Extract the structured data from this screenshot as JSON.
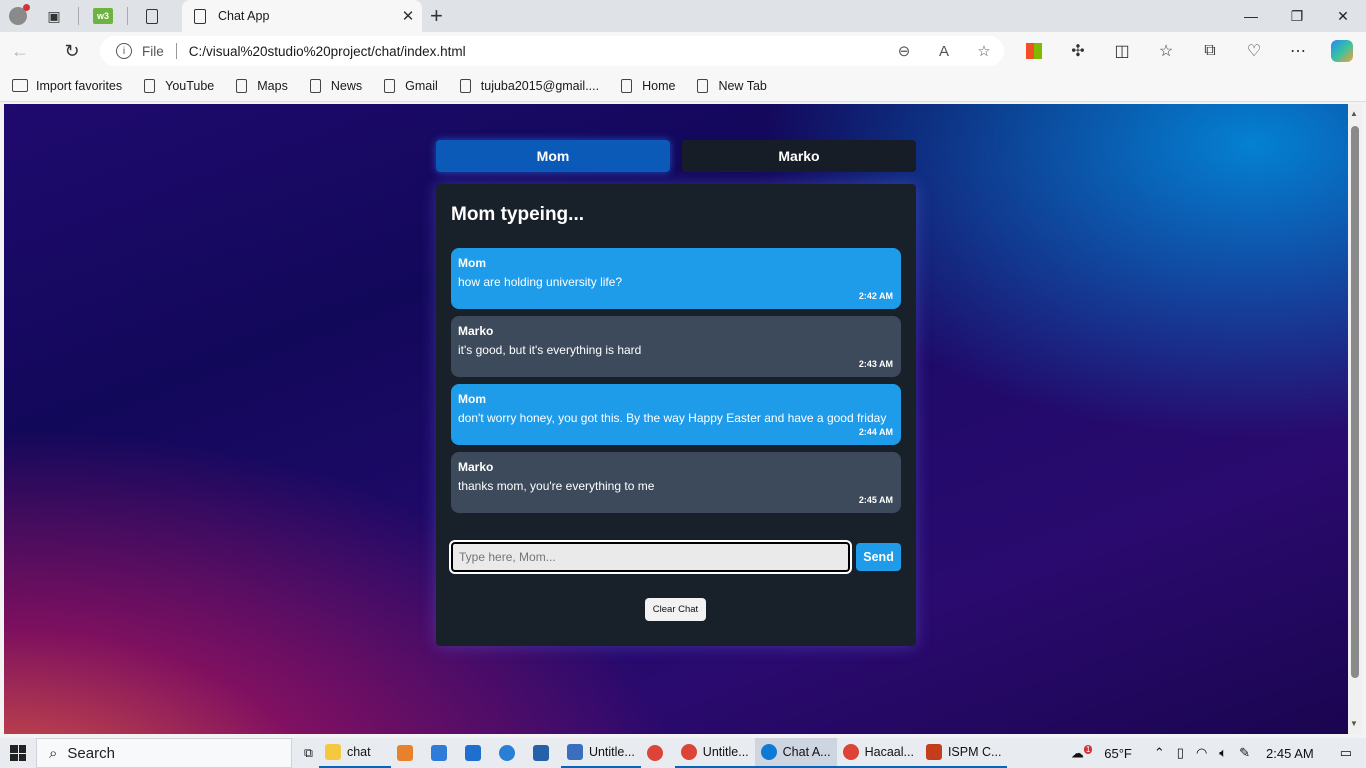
{
  "browser": {
    "tab_title": "Chat App",
    "address": {
      "scheme_label": "File",
      "url": "C:/visual%20studio%20project/chat/index.html"
    },
    "favorites": [
      {
        "label": "Import favorites",
        "icon": "import-icon"
      },
      {
        "label": "YouTube",
        "icon": "page-icon"
      },
      {
        "label": "Maps",
        "icon": "page-icon"
      },
      {
        "label": "News",
        "icon": "page-icon"
      },
      {
        "label": "Gmail",
        "icon": "page-icon"
      },
      {
        "label": "tujuba2015@gmail....",
        "icon": "page-icon"
      },
      {
        "label": "Home",
        "icon": "page-icon"
      },
      {
        "label": "New Tab",
        "icon": "page-icon"
      }
    ]
  },
  "chat": {
    "user_tabs": [
      {
        "label": "Mom",
        "active": true
      },
      {
        "label": "Marko",
        "active": false
      }
    ],
    "status_title": "Mom typeing...",
    "messages": [
      {
        "sender": "Mom",
        "text": "how are holding university life?",
        "time": "2:42 AM",
        "style": "blue"
      },
      {
        "sender": "Marko",
        "text": "it's good, but it's everything is hard",
        "time": "2:43 AM",
        "style": "gray"
      },
      {
        "sender": "Mom",
        "text": "don't worry honey, you got this. By the way Happy Easter and have a good friday",
        "time": "2:44 AM",
        "style": "blue"
      },
      {
        "sender": "Marko",
        "text": "thanks mom, you're everything to me",
        "time": "2:45 AM",
        "style": "gray"
      }
    ],
    "input_placeholder": "Type here, Mom...",
    "send_label": "Send",
    "clear_label": "Clear Chat",
    "colors": {
      "mom_bubble": "#1e9be9",
      "marko_bubble": "#3c4a5b",
      "card": "#18202a",
      "active_tab": "#0b5ab8"
    }
  },
  "taskbar": {
    "search_label": "Search",
    "items": [
      {
        "label": "chat",
        "color": "#f5c842"
      },
      {
        "label": "Untitle...",
        "color": "#3a6fbf"
      },
      {
        "label": "Untitle...",
        "color": "#db4437"
      },
      {
        "label": "Chat A...",
        "color": "#0f7ad6"
      },
      {
        "label": "Hacaal...",
        "color": "#db4437"
      },
      {
        "label": "ISPM C...",
        "color": "#c43e1c"
      }
    ],
    "weather": "65°F",
    "weather_badge": "1",
    "time": "2:45 AM"
  }
}
